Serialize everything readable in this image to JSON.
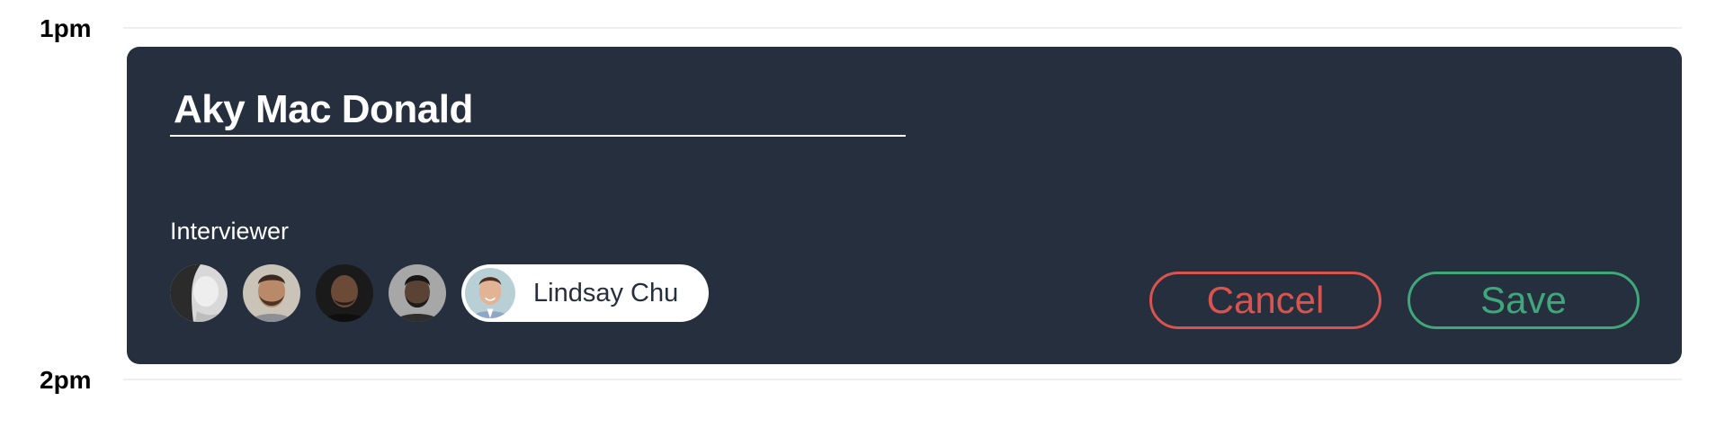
{
  "calendar": {
    "time_slots": [
      "1pm",
      "2pm"
    ]
  },
  "event": {
    "title_value": "Aky Mac Donald",
    "interviewer_label": "Interviewer",
    "interviewers": [
      {
        "icon": "avatar-woman-grayscale"
      },
      {
        "icon": "avatar-man-beard"
      },
      {
        "icon": "avatar-man-bald"
      },
      {
        "icon": "avatar-man-dark"
      }
    ],
    "selected_interviewer": {
      "name": "Lindsay Chu",
      "icon": "avatar-man-smiling"
    },
    "cancel_label": "Cancel",
    "save_label": "Save",
    "colors": {
      "card_background": "#262f3e",
      "cancel": "#d9534f",
      "save": "#3fa77a"
    }
  }
}
